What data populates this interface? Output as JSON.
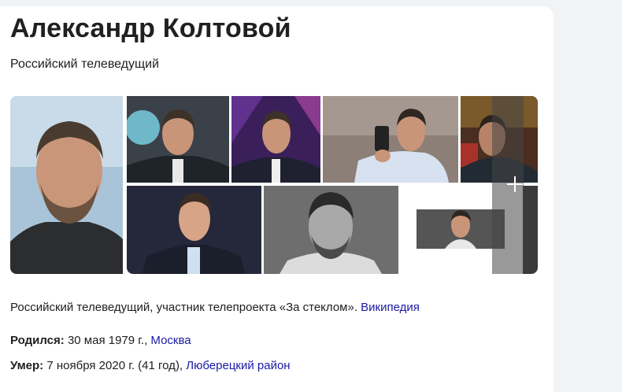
{
  "entity": {
    "title": "Александр Колтовой",
    "subtitle": "Российский телеведущий"
  },
  "gallery": {
    "photos": [
      {
        "name": "main"
      },
      {
        "name": "studio-1"
      },
      {
        "name": "studio-2"
      },
      {
        "name": "phone"
      },
      {
        "name": "selfie"
      },
      {
        "name": "portrait-suit"
      },
      {
        "name": "bw-portrait"
      },
      {
        "name": "screenshot"
      }
    ],
    "more_icon": "plus-icon"
  },
  "description": {
    "text": "Российский телеведущий, участник телепроекта «За стеклом».",
    "source_link": "Википедия"
  },
  "facts": {
    "born_label": "Родился:",
    "born_value": "30 мая 1979 г.,",
    "born_link": "Москва",
    "died_label": "Умер:",
    "died_value": "7 ноября 2020 г. (41 год),",
    "died_link": "Люберецкий район"
  },
  "colors": {
    "link": "#1a1aa6",
    "text": "#21201f",
    "background": "#f2f3f5"
  }
}
